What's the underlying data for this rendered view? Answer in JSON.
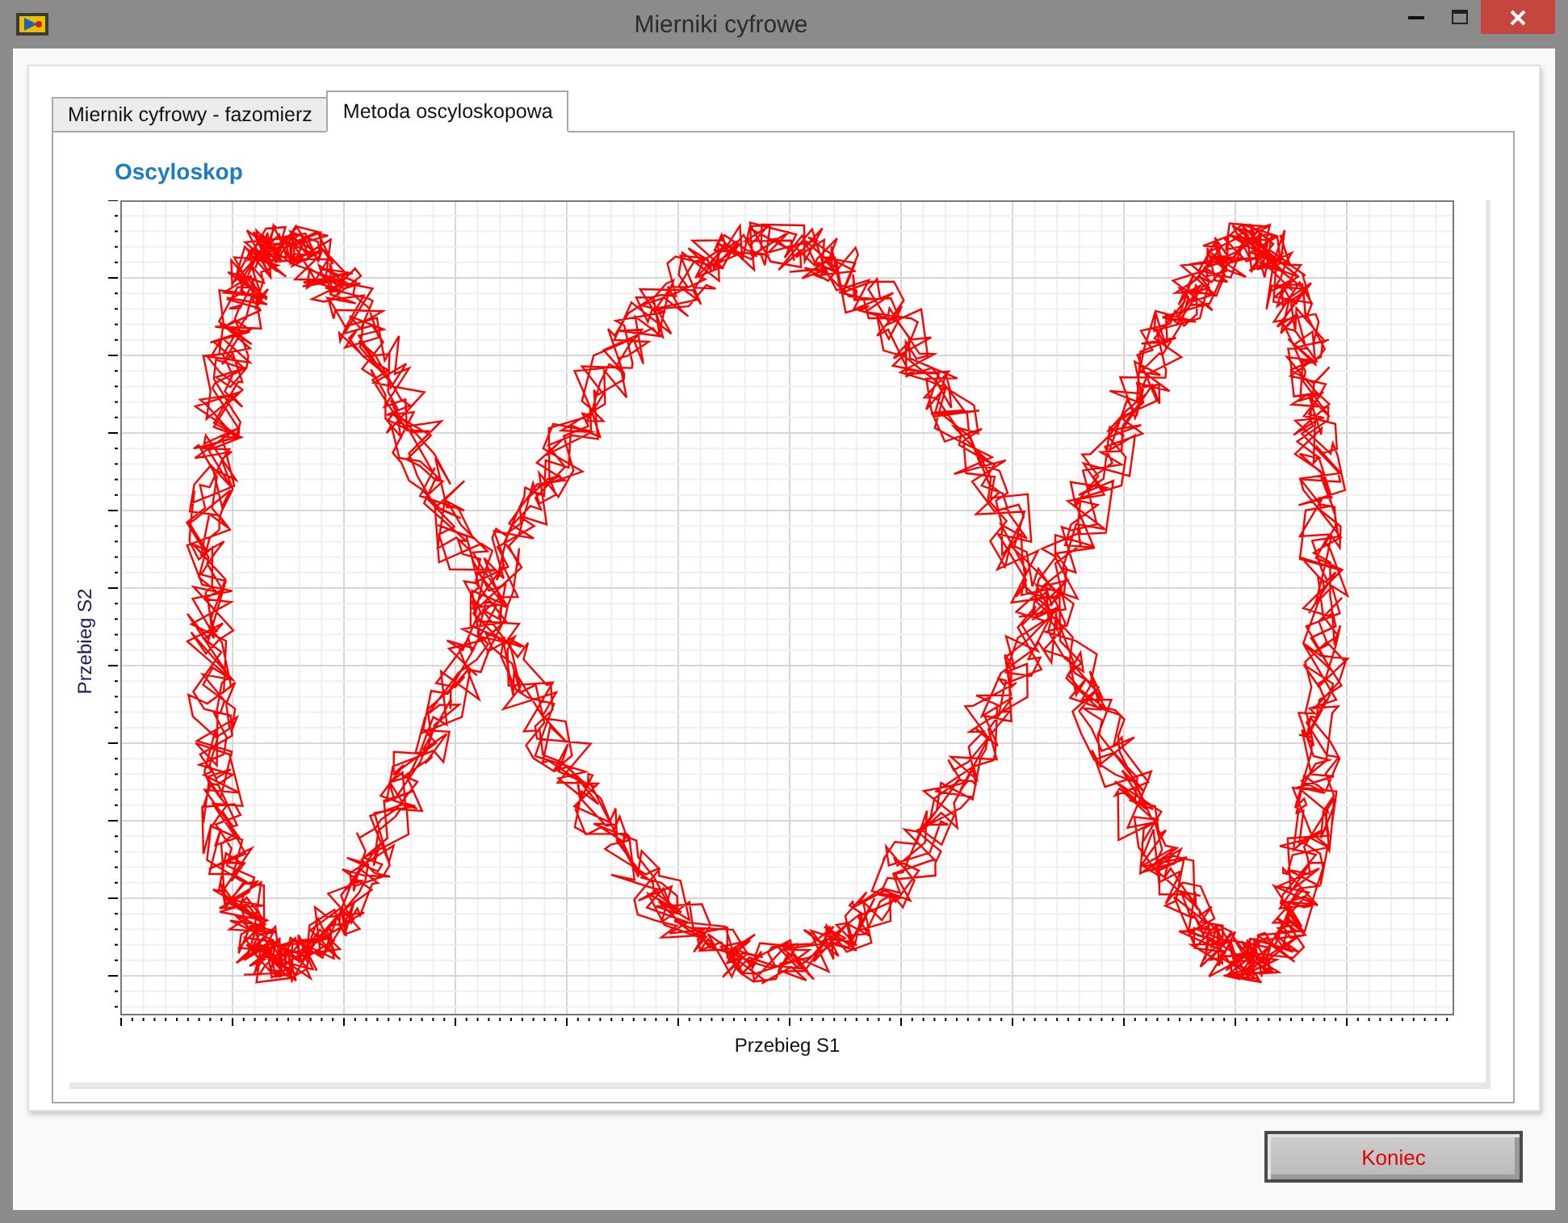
{
  "window": {
    "title": "Mierniki cyfrowe"
  },
  "tabs": [
    {
      "label": "Miernik cyfrowy - fazomierz",
      "selected": false
    },
    {
      "label": "Metoda oscyloskopowa",
      "selected": true
    }
  ],
  "graph": {
    "title": "Oscyloskop",
    "xlabel": "Przebieg S1",
    "ylabel": "Przebieg S2"
  },
  "buttons": [
    {
      "label": "Koniec"
    }
  ]
}
